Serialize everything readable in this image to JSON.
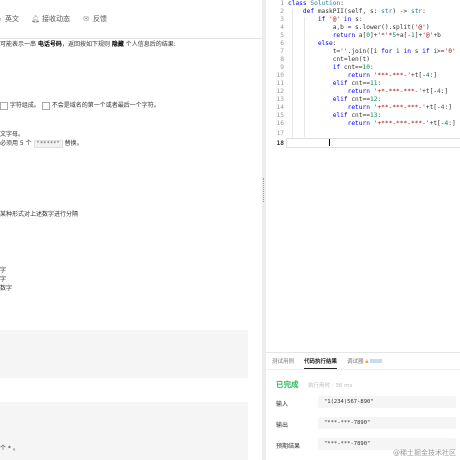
{
  "header": {
    "tabs": [
      {
        "label": "英文",
        "icon": "translate-icon"
      },
      {
        "label": "接收动态",
        "icon": "bell-icon"
      },
      {
        "label": "反馈",
        "icon": "feedback-icon"
      }
    ]
  },
  "description": {
    "line1_pre": "可能表示一串 ",
    "line1_b1": "电话号码",
    "line1_mid": "，返回按如下规则 ",
    "line1_b2": "隐藏",
    "line1_post": " 个人信息后的结果:",
    "line2_pre": "字符组成。",
    "line2_post": "不会是域名的第一个或者最后一个字符。",
    "line3": "文字母。",
    "line4_pre": "必须用 5 个 ",
    "line4_code": "\"*****\"",
    "line4_post": " 替换。",
    "line5": "某种形式对上述数字进行分隔",
    "line6": "字",
    "line7": "字",
    "line8": "数字",
    "line9": "个 * 。"
  },
  "editor": {
    "line_numbers": [
      "1",
      "2",
      "3",
      "4",
      "5",
      "6",
      "7",
      "8",
      "9",
      "10",
      "11",
      "12",
      "13",
      "14",
      "15",
      "16",
      "17",
      "18"
    ],
    "lines": [
      "class Solution:",
      "    def maskPII(self, s: str) -> str:",
      "        if '@' in s:",
      "            a,b = s.lower().split('@')",
      "            return a[0]+'*'*5+a[-1]+'@'+b",
      "        else:",
      "            t=''.join([i for i in s if i>='0' and i<='9'])",
      "            cnt=len(t)",
      "            if cnt==10:",
      "                return '***-***-'+t[-4:]",
      "            elif cnt==11:",
      "                return '+*-***-***-'+t[-4:]",
      "            elif cnt==12:",
      "                return '+**-***-***-'+t[-4:]",
      "            elif cnt==13:",
      "                return '+***-***-***-'+t[-4:]",
      "",
      ""
    ]
  },
  "result_panel": {
    "tabs": [
      "测试用例",
      "代码执行结果",
      "调试器"
    ],
    "active_tab": "代码执行结果",
    "status": "已完成",
    "runtime_label": "执行用时 : 36 ms",
    "input_label": "输入",
    "input_value": "\"1(234)567-890\"",
    "output_label": "输出",
    "output_value": "\"***-***-7890\"",
    "expected_label": "预期结果",
    "expected_value": "\"***-***-7890\""
  },
  "watermark": "@稀土掘金技术社区",
  "colors": {
    "success": "#2db55d",
    "keyword": "#0000ff",
    "string": "#a31515",
    "class": "#267f99"
  }
}
